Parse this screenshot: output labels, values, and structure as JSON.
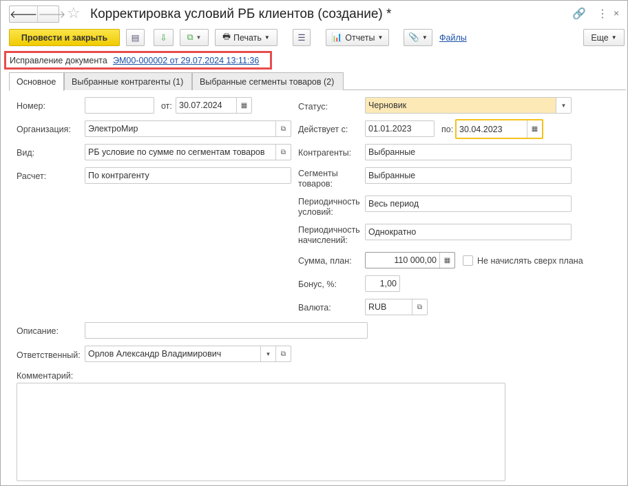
{
  "title": "Корректировка условий РБ клиентов (создание) *",
  "toolbar": {
    "post_close": "Провести и закрыть",
    "print": "Печать",
    "reports": "Отчеты",
    "files": "Файлы",
    "more": "Еще"
  },
  "correction": {
    "label": "Исправление документа",
    "link": "ЭМ00-000002 от 29.07.2024 13:11:36"
  },
  "tabs": [
    "Основное",
    "Выбранные контрагенты (1)",
    "Выбранные сегменты товаров (2)"
  ],
  "left": {
    "number_label": "Номер:",
    "number": "",
    "date_label": "от:",
    "date": "30.07.2024",
    "org_label": "Организация:",
    "org": "ЭлектроМир",
    "kind_label": "Вид:",
    "kind": "РБ условие по сумме по сегментам товаров",
    "calc_label": "Расчет:",
    "calc": "По контрагенту"
  },
  "right": {
    "status_label": "Статус:",
    "status": "Черновик",
    "from_label": "Действует с:",
    "from": "01.01.2023",
    "to_label": "по:",
    "to": "30.04.2023",
    "partners_label": "Контрагенты:",
    "partners": "Выбранные",
    "segments_label": "Сегменты товаров:",
    "segments": "Выбранные",
    "cond_label": "Периодичность условий:",
    "cond": "Весь период",
    "accr_label": "Периодичность начислений:",
    "accr": "Однократно",
    "sum_label": "Сумма, план:",
    "sum": "110 000,00",
    "no_over_label": "Не начислять сверх плана",
    "no_over": false,
    "bonus_label": "Бонус, %:",
    "bonus": "1,00",
    "cur_label": "Валюта:",
    "cur": "RUB"
  },
  "bottom": {
    "desc_label": "Описание:",
    "desc": "",
    "resp_label": "Ответственный:",
    "resp": "Орлов Александр Владимирович",
    "comment_label": "Комментарий:",
    "comment": ""
  },
  "colors": {
    "accent": "#f5d40f",
    "status_bg": "#fce9b6",
    "highlight": "#e84b4b"
  }
}
